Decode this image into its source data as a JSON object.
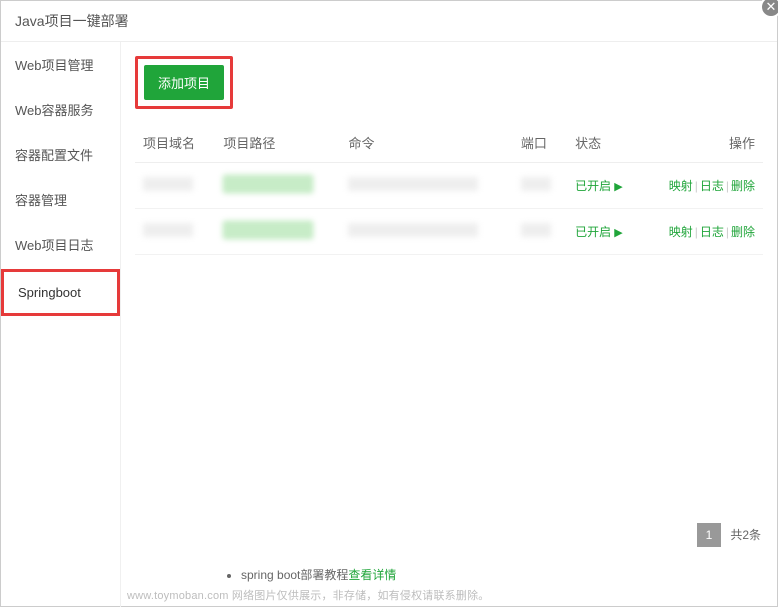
{
  "window": {
    "title": "Java项目一键部署",
    "close": "✕"
  },
  "sidebar": {
    "items": [
      {
        "label": "Web项目管理"
      },
      {
        "label": "Web容器服务"
      },
      {
        "label": "容器配置文件"
      },
      {
        "label": "容器管理"
      },
      {
        "label": "Web项目日志"
      },
      {
        "label": "Springboot"
      }
    ]
  },
  "toolbar": {
    "add": "添加项目"
  },
  "table": {
    "headers": {
      "domain": "项目域名",
      "path": "项目路径",
      "cmd": "命令",
      "port": "端口",
      "status": "状态",
      "ops": "操作"
    },
    "rows": [
      {
        "status": "已开启",
        "ops": {
          "map": "映射",
          "log": "日志",
          "del": "删除"
        }
      },
      {
        "status": "已开启",
        "ops": {
          "map": "映射",
          "log": "日志",
          "del": "删除"
        }
      }
    ]
  },
  "pager": {
    "page": "1",
    "total": "共2条"
  },
  "tip": {
    "text": "spring boot部署教程",
    "link": "查看详情"
  },
  "watermark": "www.toymoban.com    网络图片仅供展示，非存储，如有侵权请联系删除。"
}
